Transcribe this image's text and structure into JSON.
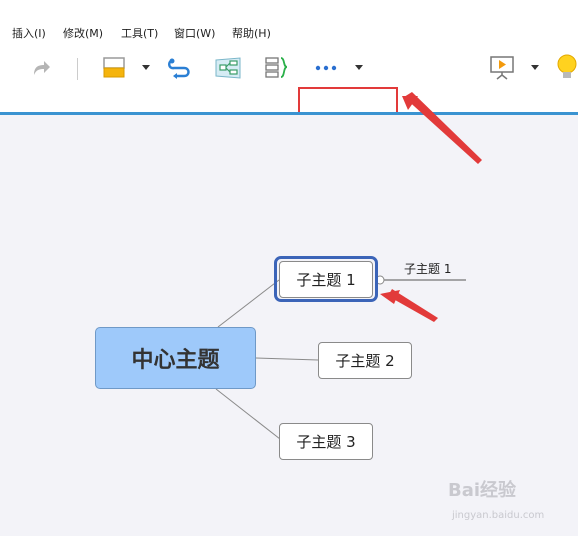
{
  "menu": [
    {
      "label": "插入(I)"
    },
    {
      "label": "修改(M)"
    },
    {
      "label": "工具(T)"
    },
    {
      "label": "窗口(W)"
    },
    {
      "label": "帮助(H)"
    }
  ],
  "toolbar": {
    "icons": [
      "redo-icon",
      "topic-insert-icon",
      "relationship-icon",
      "summary-frame-icon",
      "boundary-icon",
      "more-icon",
      "presentation-icon",
      "idea-bulb-icon"
    ]
  },
  "mindmap": {
    "central_topic": "中心主题",
    "subtopics": [
      "子主题 1",
      "子主题 2",
      "子主题 3"
    ],
    "child_of_subtopic1": "子主题 1"
  },
  "watermark": {
    "text": "Bai经验",
    "sub": "jingyan.baidu.com"
  },
  "colors": {
    "accent_blue": "#3a93d1",
    "central_fill": "#9ec9fa",
    "annotation_red": "#e23a3a",
    "selection_blue": "#3b64b8"
  }
}
